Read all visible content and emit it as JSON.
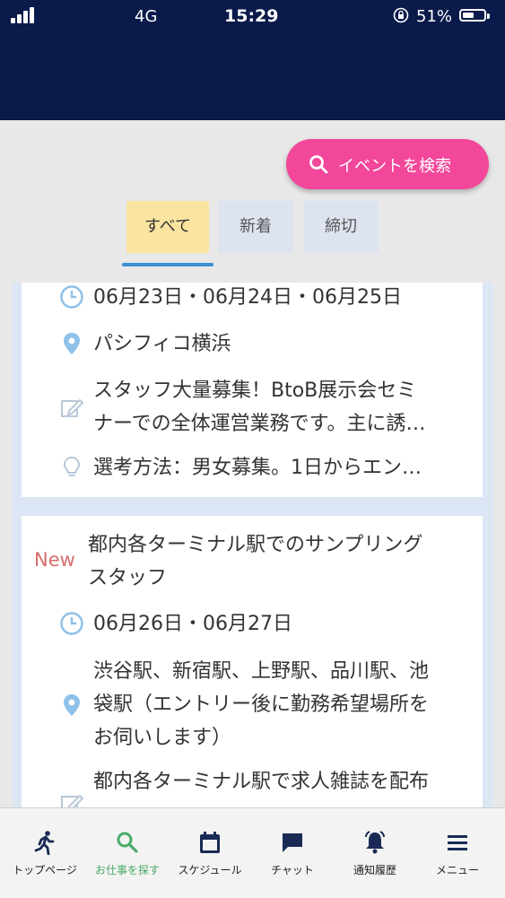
{
  "status_bar": {
    "carrier": "4G",
    "time": "15:29",
    "battery": "51%"
  },
  "search": {
    "label": "イベントを検索"
  },
  "tabs": [
    {
      "label": "すべて",
      "active": true
    },
    {
      "label": "新着",
      "active": false
    },
    {
      "label": "締切",
      "active": false
    }
  ],
  "cards": [
    {
      "dates": "06月23日・06月24日・06月25日",
      "location": "パシフィコ横浜",
      "description": [
        "スタッフ大量募集！BtoB展示会セミ",
        "ナーでの全体運営業務です。主に誘…"
      ],
      "selection": "選考方法：男女募集。1日からエン…"
    },
    {
      "badge": "New",
      "title": [
        "都内各ターミナル駅でのサンプリング",
        "スタッフ"
      ],
      "dates": "06月26日・06月27日",
      "location": [
        "渋谷駅、新宿駅、上野駅、品川駅、池",
        "袋駅（エントリー後に勤務希望場所を",
        "お伺いします）"
      ],
      "description": "都内各ターミナル駅で求人雑誌を配布"
    }
  ],
  "bottom_nav": [
    {
      "label": "トップページ",
      "icon": "runner-icon"
    },
    {
      "label": "お仕事を探す",
      "icon": "search-icon",
      "active": true
    },
    {
      "label": "スケジュール",
      "icon": "calendar-icon"
    },
    {
      "label": "チャット",
      "icon": "chat-icon"
    },
    {
      "label": "通知履歴",
      "icon": "bell-icon"
    },
    {
      "label": "メニュー",
      "icon": "hamburger-icon"
    }
  ],
  "colors": {
    "header": "#0a1a4a",
    "accent_pink": "#f2479a",
    "tab_active": "#fbe3a0",
    "tab_inactive": "#dde3ef",
    "underline": "#3a90d4",
    "new_badge": "#d76d6d",
    "nav_active": "#4aaa6a",
    "icon_blue": "#8ec1ea"
  }
}
